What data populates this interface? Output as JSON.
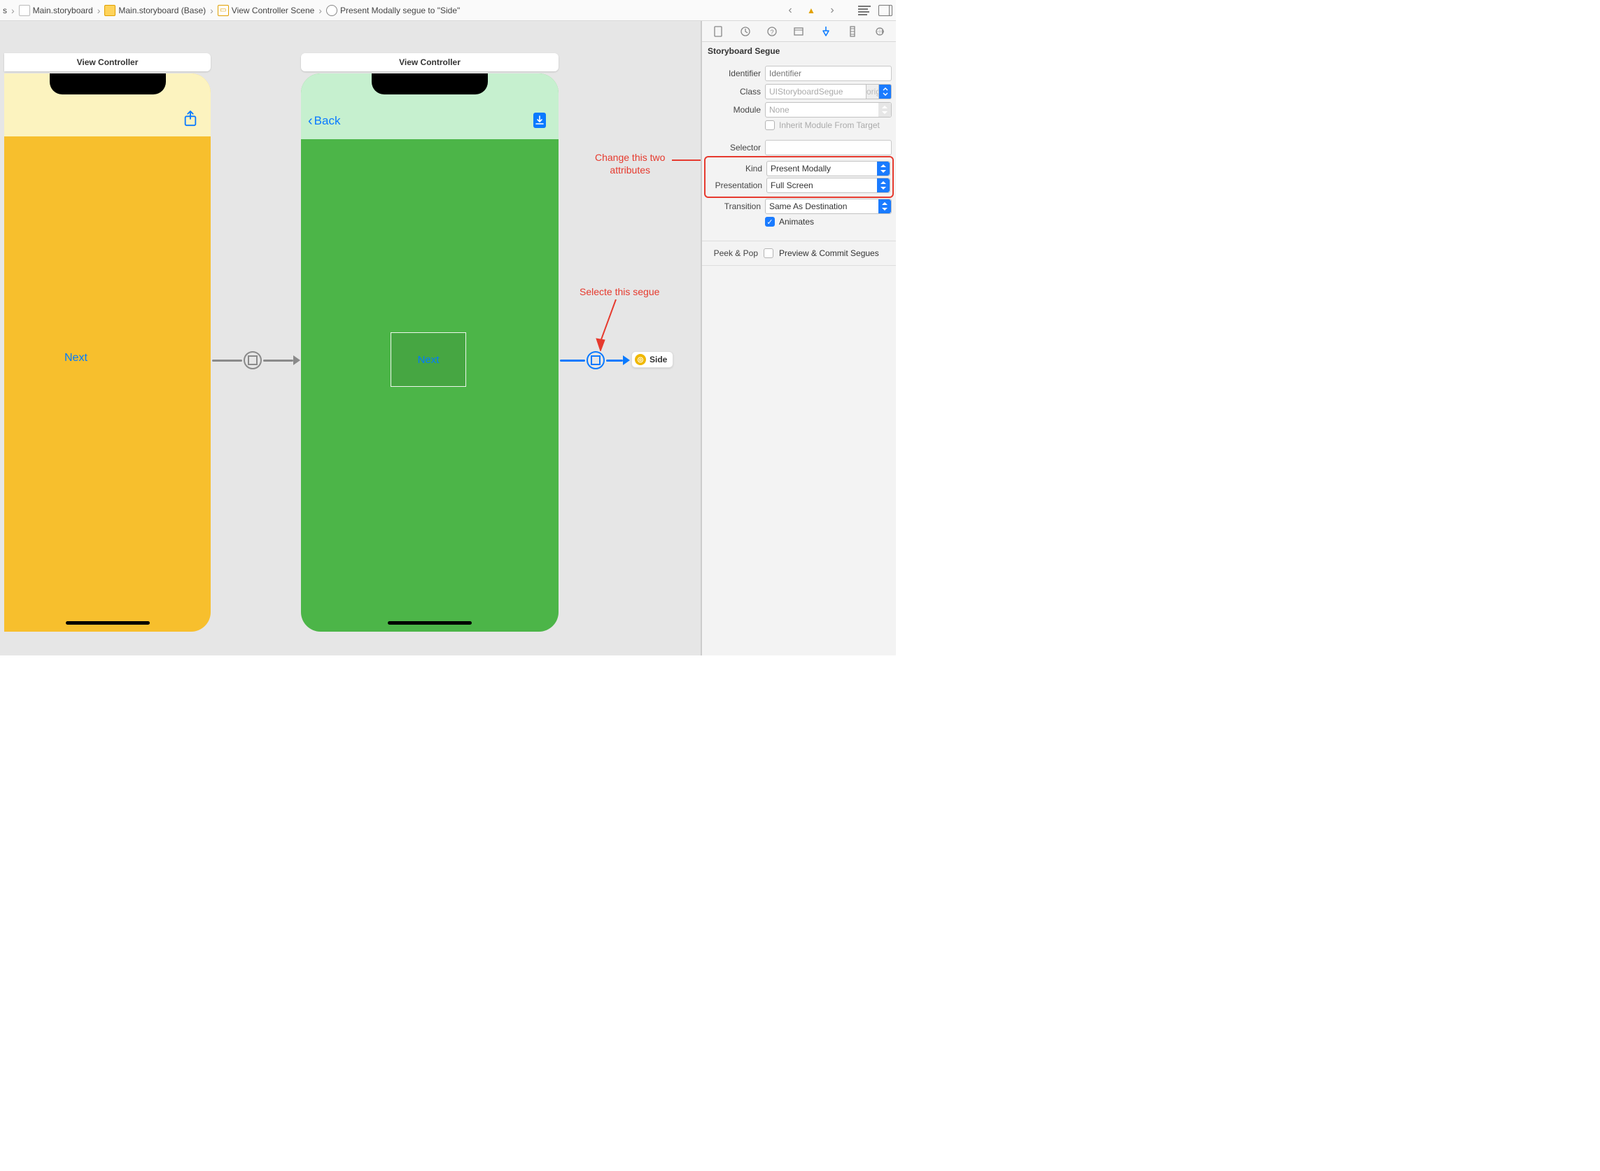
{
  "breadcrumbs": {
    "root_suffix": "s",
    "file": "Main.storyboard",
    "base": "Main.storyboard (Base)",
    "scene": "View Controller Scene",
    "segue": "Present Modally segue to \"Side\""
  },
  "canvas": {
    "vc1_title": "View Controller",
    "vc2_title": "View Controller",
    "vc1_button": "Next",
    "vc2_back": "Back",
    "vc2_button": "Next",
    "side_label": "Side"
  },
  "annotations": {
    "change_attrs": "Change this two\nattributes",
    "select_segue": "Selecte this segue"
  },
  "inspector": {
    "header": "Storyboard Segue",
    "fields": {
      "identifier_label": "Identifier",
      "identifier_placeholder": "Identifier",
      "class_label": "Class",
      "class_value": "UIStoryboardSegue",
      "module_label": "Module",
      "module_value": "None",
      "inherit_label": "Inherit Module From Target",
      "inherit_checked": false,
      "selector_label": "Selector",
      "selector_value": "",
      "kind_label": "Kind",
      "kind_value": "Present Modally",
      "presentation_label": "Presentation",
      "presentation_value": "Full Screen",
      "transition_label": "Transition",
      "transition_value": "Same As Destination",
      "animates_label": "Animates",
      "animates_checked": true
    },
    "peek": {
      "label": "Peek & Pop",
      "option": "Preview & Commit Segues",
      "checked": false
    }
  }
}
